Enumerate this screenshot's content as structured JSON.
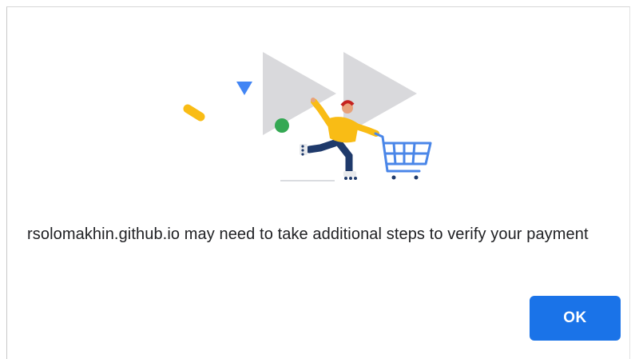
{
  "dialog": {
    "message": "rsolomakhin.github.io may need to take additional steps to verify your payment",
    "ok_label": "OK"
  },
  "illustration": {
    "name": "shopping-skater-illustration",
    "elements": [
      "play-triangle-icon",
      "play-triangle-icon",
      "blue-triangle-icon",
      "yellow-pill-shape",
      "green-dot-shape",
      "skater-figure",
      "shopping-cart-icon"
    ]
  },
  "colors": {
    "accent": "#1a73e8",
    "text": "#202124",
    "triangle_gray": "#d9d9dc",
    "yellow": "#f9bc15",
    "green": "#34a853",
    "navy": "#1f3a6b",
    "cart_blue": "#4a86e8"
  }
}
